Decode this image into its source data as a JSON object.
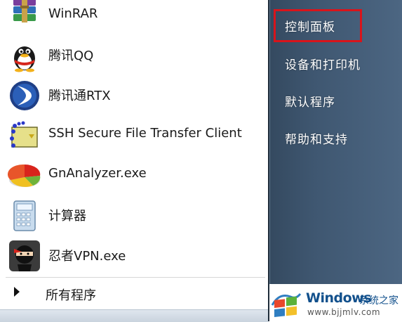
{
  "programs": [
    {
      "label": "WinRAR",
      "icon": "winrar-icon"
    },
    {
      "label": "腾讯QQ",
      "icon": "qq-penguin-icon"
    },
    {
      "label": "腾讯通RTX",
      "icon": "rtx-icon"
    },
    {
      "label": "SSH Secure File Transfer Client",
      "icon": "ssh-transfer-icon"
    },
    {
      "label": "GnAnalyzer.exe",
      "icon": "gnanalyzer-icon"
    },
    {
      "label": "计算器",
      "icon": "calculator-icon"
    },
    {
      "label": "忍者VPN.exe",
      "icon": "ninja-vpn-icon"
    }
  ],
  "all_programs": {
    "label": "所有程序",
    "icon": "triangle-right-icon"
  },
  "right_links": [
    {
      "label": "控制面板",
      "highlighted": true
    },
    {
      "label": "设备和打印机"
    },
    {
      "label": "默认程序"
    },
    {
      "label": "帮助和支持"
    }
  ],
  "watermark": {
    "brand": "Windows",
    "cn": "系统之家",
    "url": "www.bjjmlv.com"
  },
  "colors": {
    "highlight": "#d8141b",
    "right_pane": "#3f5771",
    "brand": "#12508c"
  }
}
